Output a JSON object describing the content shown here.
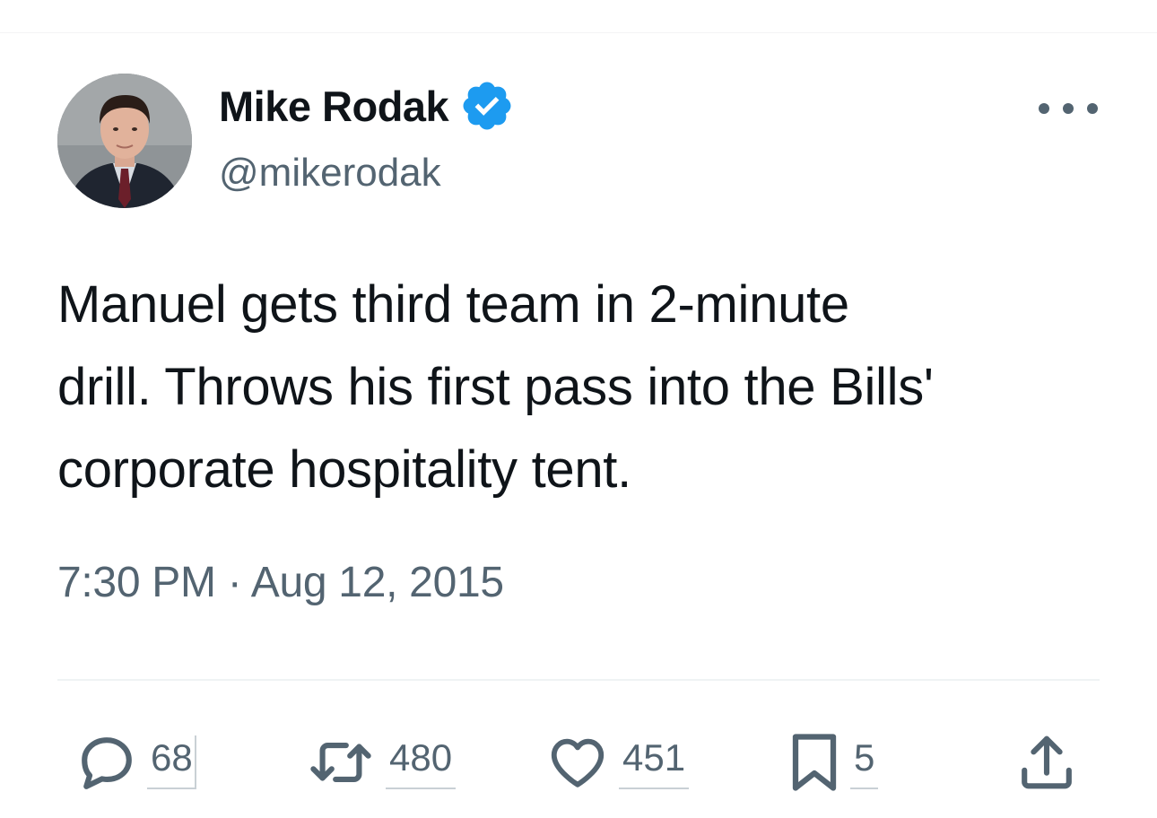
{
  "author": {
    "display_name": "Mike Rodak",
    "handle": "@mikerodak",
    "verified": true,
    "verified_icon": "verified-badge-icon",
    "verified_color": "#1d9bf0"
  },
  "tweet": {
    "text": "Manuel gets third team in 2-minute\ndrill. Throws his first pass into the Bills'\ncorporate hospitality tent.",
    "timestamp": "7:30 PM · Aug 12, 2015"
  },
  "actions": {
    "replies": {
      "icon": "reply-icon",
      "count": "68"
    },
    "reposts": {
      "icon": "repost-icon",
      "count": "480"
    },
    "likes": {
      "icon": "heart-icon",
      "count": "451"
    },
    "bookmarks": {
      "icon": "bookmark-icon",
      "count": "5"
    },
    "share": {
      "icon": "share-icon"
    }
  },
  "menu": {
    "icon": "more-icon"
  },
  "colors": {
    "text": "#0f1419",
    "secondary": "#536471",
    "accent": "#1d9bf0",
    "divider": "#eff3f4"
  }
}
